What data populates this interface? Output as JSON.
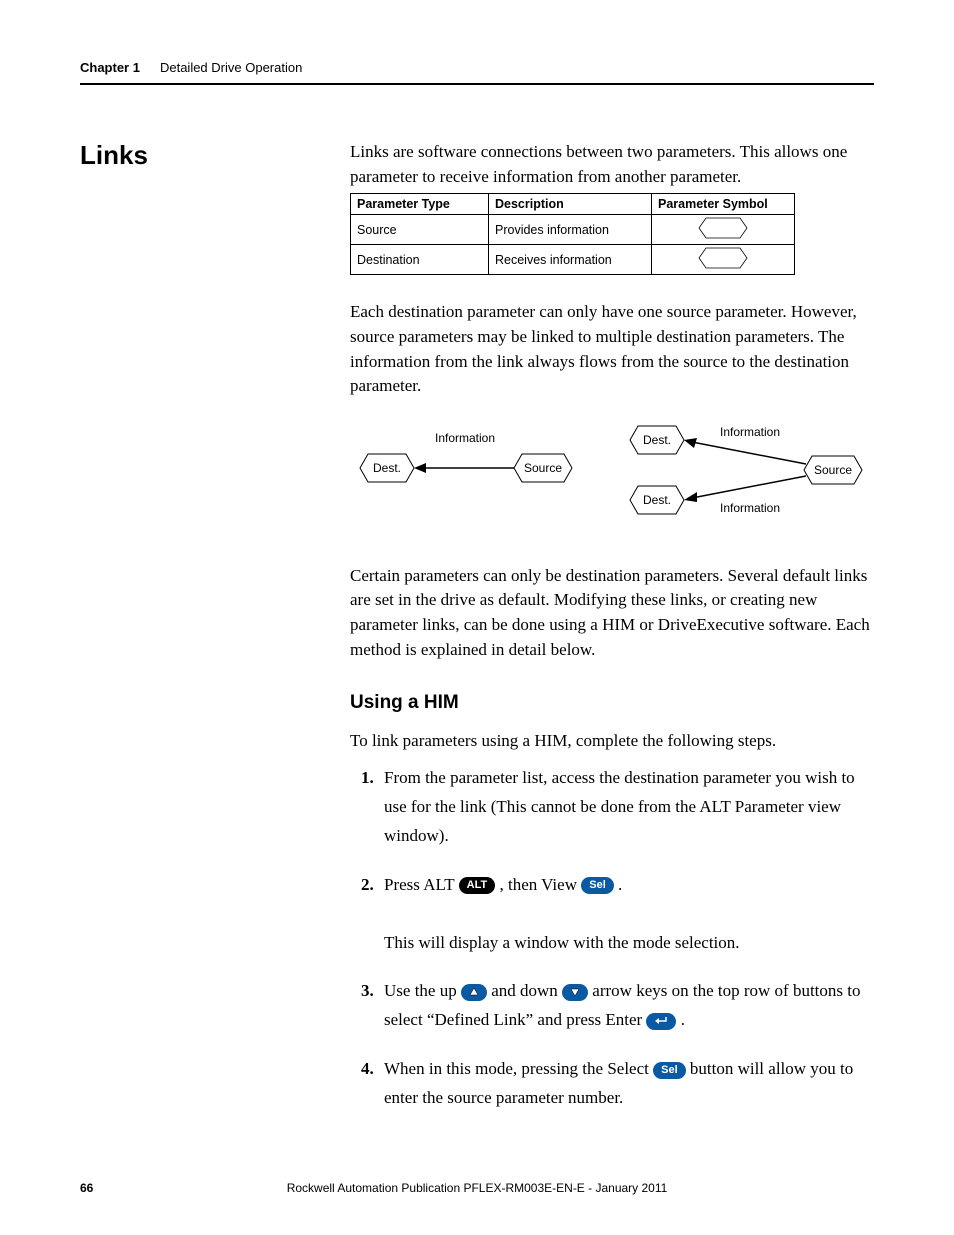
{
  "header": {
    "chapter": "Chapter 1",
    "title": "Detailed Drive Operation"
  },
  "section": {
    "title": "Links",
    "intro": "Links are software connections between two parameters. This allows one parameter to receive information from another parameter."
  },
  "table": {
    "headers": [
      "Parameter Type",
      "Description",
      "Parameter Symbol"
    ],
    "rows": [
      {
        "type": "Source",
        "desc": "Provides information"
      },
      {
        "type": "Destination",
        "desc": "Receives information"
      }
    ]
  },
  "para2": "Each destination parameter can only have one source parameter. However, source parameters may be linked to multiple destination parameters. The information from the link always flows from the source to the destination parameter.",
  "diagram": {
    "dest": "Dest.",
    "source": "Source",
    "info": "Information"
  },
  "para3": "Certain parameters can only be destination parameters. Several default links are set in the drive as default. Modifying these links, or creating new parameter links, can be done using a HIM or DriveExecutive software. Each method is explained in detail below.",
  "sub1": {
    "title": "Using a HIM",
    "lead": "To link parameters using a HIM, complete the following steps."
  },
  "steps": {
    "s1": "From the parameter list, access the destination parameter you wish to use for the link (This cannot be done from the ALT Parameter view window).",
    "s2a": "Press ALT ",
    "s2b": " , then View ",
    "s2c": " .",
    "s2note": "This will display a window with the mode selection.",
    "s3a": "Use the up ",
    "s3b": " and down ",
    "s3c": " arrow keys on the top row of buttons to select “Defined Link” and press Enter ",
    "s3d": ".",
    "s4a": "When in this mode, pressing the Select ",
    "s4b": " button will allow you to enter the source parameter number."
  },
  "labels": {
    "alt": "ALT",
    "sel": "Sel"
  },
  "footer": {
    "page": "66",
    "pub": "Rockwell Automation Publication PFLEX-RM003E-EN-E - January 2011"
  }
}
